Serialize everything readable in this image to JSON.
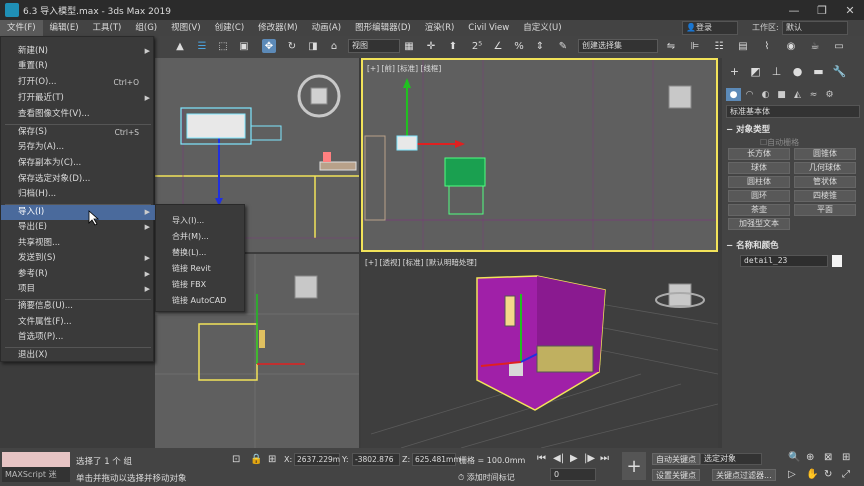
{
  "window": {
    "title": "6.3 导入模型.max - 3ds Max 2019",
    "buttons": [
      "—",
      "❐",
      "✕"
    ]
  },
  "menubar": {
    "items": [
      "文件(F)",
      "编辑(E)",
      "工具(T)",
      "组(G)",
      "视图(V)",
      "创建(C)",
      "修改器(M)",
      "动画(A)",
      "图形编辑器(D)",
      "渲染(R)",
      "Civil View",
      "自定义(U)"
    ],
    "login": "登录",
    "workspace_label": "工作区:",
    "workspace_value": "默认"
  },
  "toolbar": {
    "view_select": "视图",
    "selection_set": "创建选择集"
  },
  "file_menu": {
    "items": [
      {
        "label": "新建(N)",
        "shortcut": "",
        "arrow": "▶"
      },
      {
        "label": "重置(R)",
        "shortcut": "",
        "arrow": ""
      },
      {
        "label": "打开(O)...",
        "shortcut": "Ctrl+O",
        "arrow": ""
      },
      {
        "label": "打开最近(T)",
        "shortcut": "",
        "arrow": "▶"
      },
      {
        "label": "查看图像文件(V)...",
        "shortcut": "",
        "arrow": ""
      },
      {
        "label": "保存(S)",
        "shortcut": "Ctrl+S",
        "arrow": ""
      },
      {
        "label": "另存为(A)...",
        "shortcut": "",
        "arrow": ""
      },
      {
        "label": "保存副本为(C)...",
        "shortcut": "",
        "arrow": ""
      },
      {
        "label": "保存选定对象(D)...",
        "shortcut": "",
        "arrow": ""
      },
      {
        "label": "归档(H)...",
        "shortcut": "",
        "arrow": ""
      },
      {
        "label": "导入(I)",
        "shortcut": "",
        "arrow": "▶"
      },
      {
        "label": "导出(E)",
        "shortcut": "",
        "arrow": "▶"
      },
      {
        "label": "共享视图...",
        "shortcut": "",
        "arrow": ""
      },
      {
        "label": "发送到(S)",
        "shortcut": "",
        "arrow": "▶"
      },
      {
        "label": "参考(R)",
        "shortcut": "",
        "arrow": "▶"
      },
      {
        "label": "项目",
        "shortcut": "",
        "arrow": "▶"
      },
      {
        "label": "摘要信息(U)...",
        "shortcut": "",
        "arrow": ""
      },
      {
        "label": "文件属性(F)...",
        "shortcut": "",
        "arrow": ""
      },
      {
        "label": "首选项(P)...",
        "shortcut": "",
        "arrow": ""
      },
      {
        "label": "退出(X)",
        "shortcut": "",
        "arrow": ""
      }
    ],
    "import_submenu": [
      "导入(I)...",
      "合并(M)...",
      "替换(L)...",
      "链接 Revit",
      "链接 FBX",
      "链接 AutoCAD"
    ]
  },
  "viewports": {
    "front_label": "[+] [前] [标准] [线框]",
    "persp_label": "[+] [透视] [标准] [默认明暗处理]",
    "cube_labels": [
      "前",
      "前",
      "上",
      "前"
    ]
  },
  "command_panel": {
    "category": "标准基本体",
    "object_type_title": "对象类型",
    "autogrid": "自动栅格",
    "buttons": [
      "长方体",
      "圆锥体",
      "球体",
      "几何球体",
      "圆柱体",
      "管状体",
      "圆环",
      "四棱锥",
      "茶壶",
      "平面",
      "加强型文本"
    ],
    "name_color_title": "名称和颜色",
    "object_name": "detail_23",
    "swatch_color": "#f4f4f4"
  },
  "status": {
    "maxscript_label": "MAXScript 迷",
    "selected": "选择了 1 个 组",
    "hint": "单击并拖动以选择并移动对象",
    "x_label": "X:",
    "x_value": "2637.229m",
    "y_label": "Y:",
    "y_value": "-3802.876",
    "z_label": "Z:",
    "z_value": "625.481mm",
    "grid": "栅格 = 100.0mm",
    "add_time_tag": "添加时间标记",
    "frame": "0",
    "auto_key": "自动关键点",
    "set_key": "设置关键点",
    "key_select": "选定对象",
    "key_filter": "关键点过滤器..."
  },
  "colors": {
    "accent_highlight": "#4a6a9c",
    "selection_yellow": "#f2e35a",
    "room_magenta": "#a020a8",
    "gizmo_red": "#e02020",
    "gizmo_green": "#20c020",
    "gizmo_blue": "#2030e0"
  }
}
